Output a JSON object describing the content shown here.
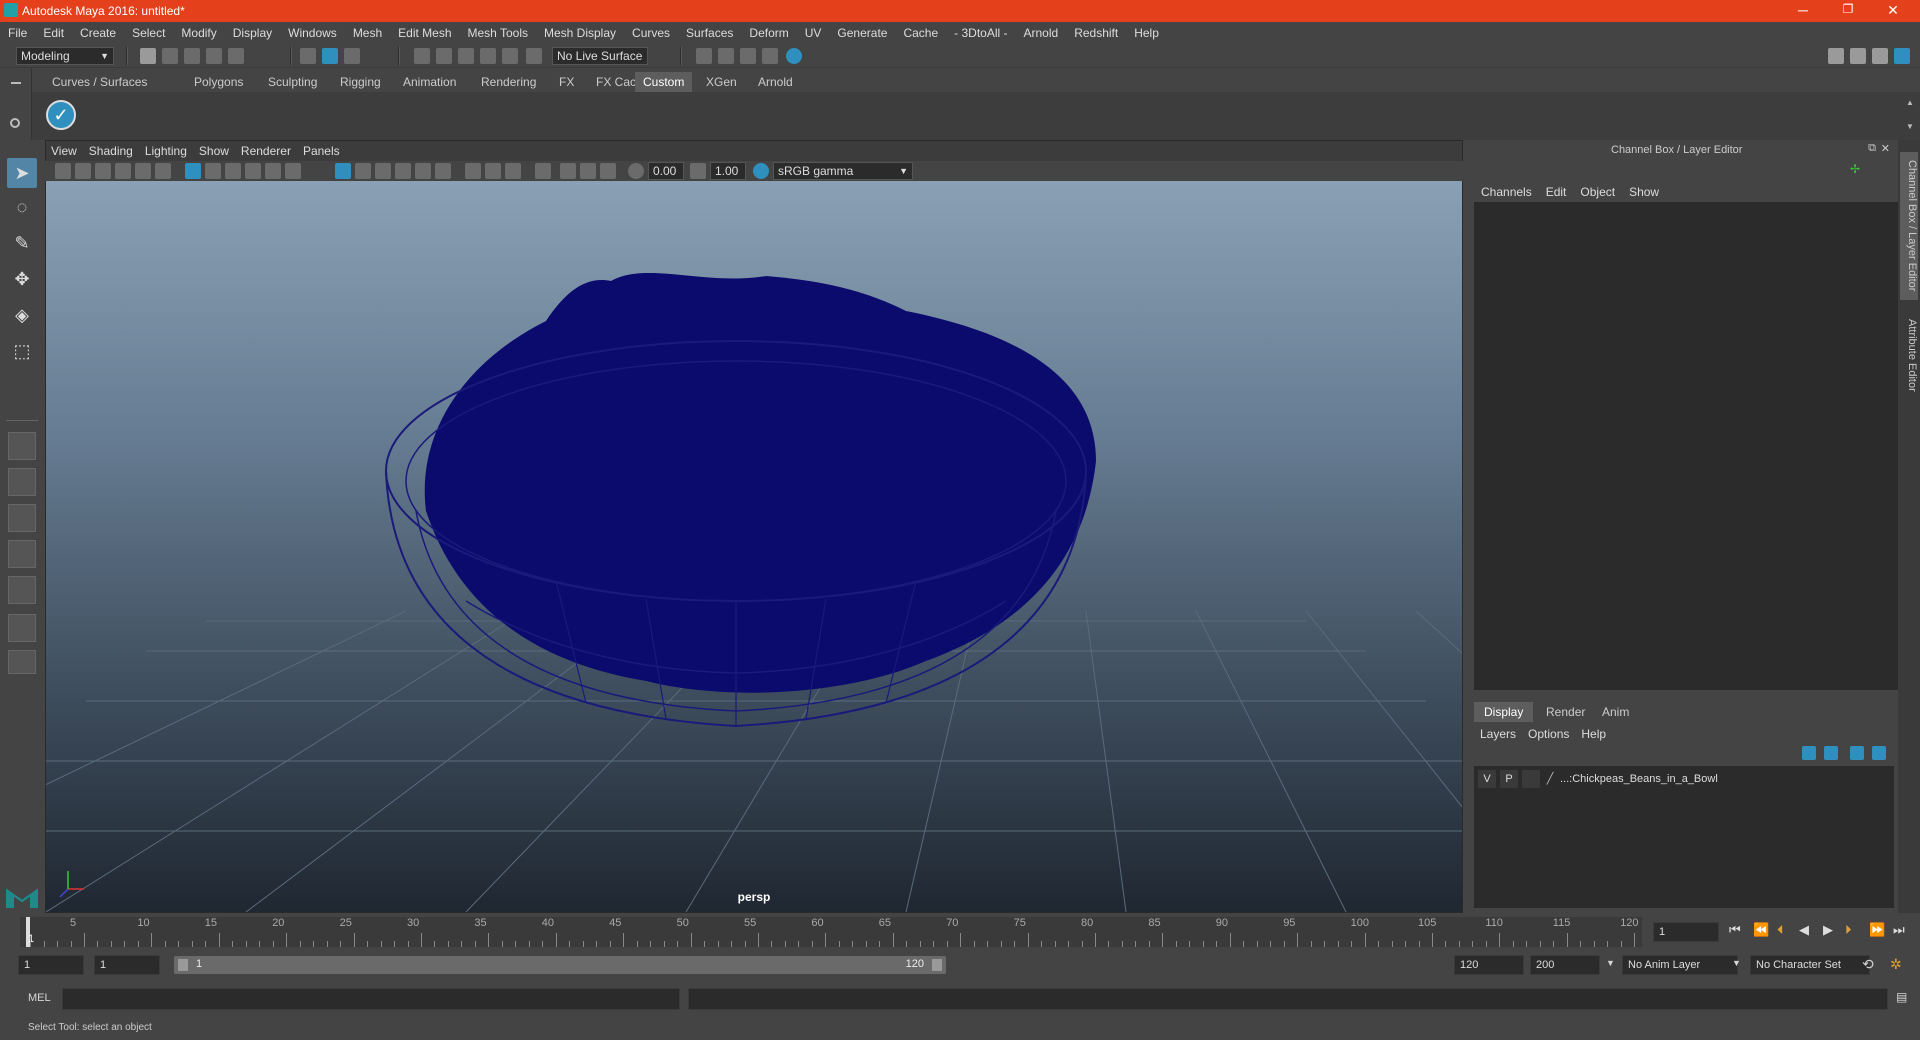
{
  "window": {
    "title": "Autodesk Maya 2016: untitled*",
    "minimize_glyph": "─",
    "restore_glyph": "❐",
    "close_glyph": "✕"
  },
  "menubar": [
    "File",
    "Edit",
    "Create",
    "Select",
    "Modify",
    "Display",
    "Windows",
    "Mesh",
    "Edit Mesh",
    "Mesh Tools",
    "Mesh Display",
    "Curves",
    "Surfaces",
    "Deform",
    "UV",
    "Generate",
    "Cache",
    "- 3DtoAll -",
    "Arnold",
    "Redshift",
    "Help"
  ],
  "statusline": {
    "mode": "Modeling",
    "live_surface": "No Live Surface"
  },
  "shelf_tabs": [
    "Curves / Surfaces",
    "Polygons",
    "Sculpting",
    "Rigging",
    "Animation",
    "Rendering",
    "FX",
    "FX Caching",
    "Custom",
    "XGen",
    "Arnold"
  ],
  "shelf_active": "Custom",
  "viewport": {
    "menu": [
      "View",
      "Shading",
      "Lighting",
      "Show",
      "Renderer",
      "Panels"
    ],
    "exposure": "0.00",
    "gamma": "1.00",
    "colorspace": "sRGB gamma",
    "camera": "persp",
    "mesh_color": "#0b0b6e",
    "wire_color": "#1a1a7a"
  },
  "channelbox": {
    "title": "Channel Box / Layer Editor",
    "menu": [
      "Channels",
      "Edit",
      "Object",
      "Show"
    ],
    "side_tabs": [
      "Channel Box / Layer Editor",
      "Attribute Editor"
    ],
    "layer_tabs": [
      "Display",
      "Render",
      "Anim"
    ],
    "layer_menu": [
      "Layers",
      "Options",
      "Help"
    ],
    "layer": {
      "v": "V",
      "p": "P",
      "name": "...:Chickpeas_Beans_in_a_Bowl"
    }
  },
  "timeslider": {
    "ticks": [
      "5",
      "10",
      "15",
      "20",
      "25",
      "30",
      "35",
      "40",
      "45",
      "50",
      "55",
      "60",
      "65",
      "70",
      "75",
      "80",
      "85",
      "90",
      "95",
      "100",
      "105",
      "110",
      "115",
      "120"
    ],
    "current_frame": "1",
    "frame_field": "1"
  },
  "range": {
    "start": "1",
    "playback_start": "1",
    "slider_start": "1",
    "slider_end": "120",
    "playback_end": "120",
    "end": "200",
    "anim_layer": "No Anim Layer",
    "character_set": "No Character Set"
  },
  "cmd": {
    "label": "MEL"
  },
  "help": {
    "text": "Select Tool: select an object"
  }
}
